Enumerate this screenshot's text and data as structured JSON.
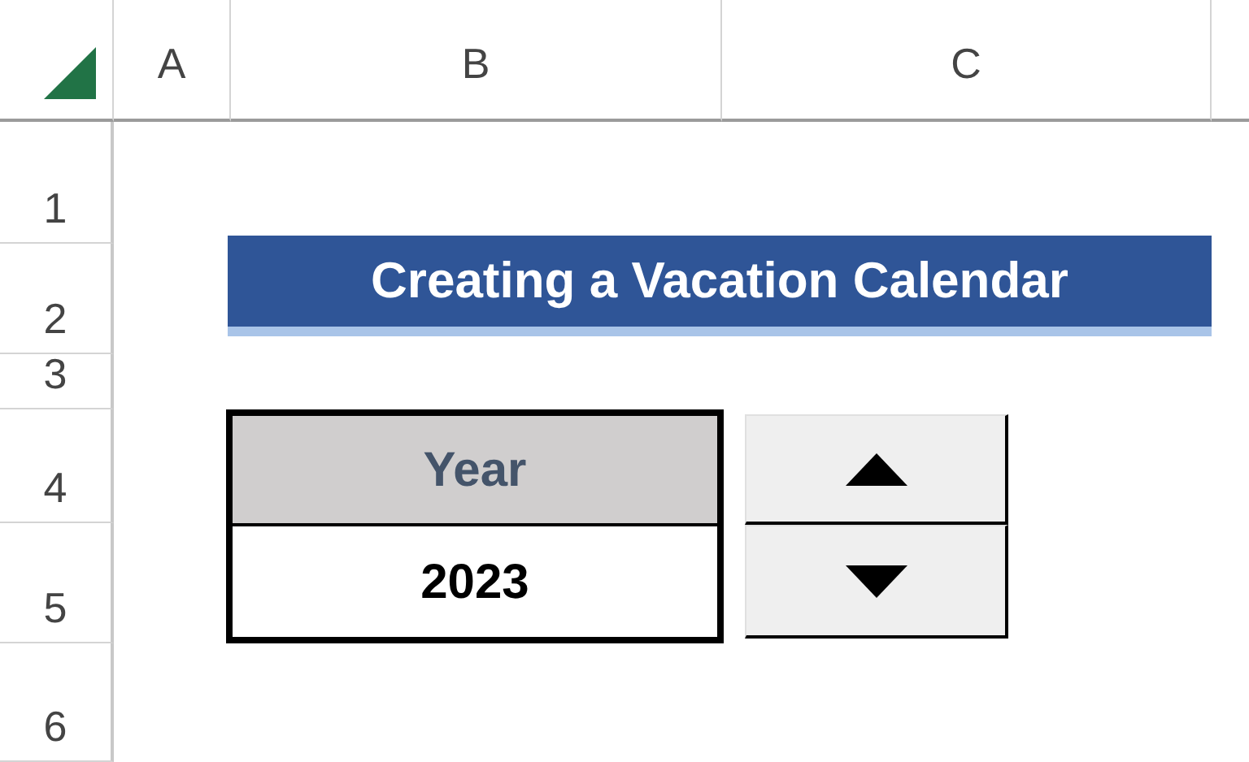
{
  "column_headers": [
    "A",
    "B",
    "C"
  ],
  "row_headers": [
    "1",
    "2",
    "3",
    "4",
    "5",
    "6"
  ],
  "title": "Creating a Vacation Calendar",
  "table": {
    "header": "Year",
    "value": "2023"
  }
}
